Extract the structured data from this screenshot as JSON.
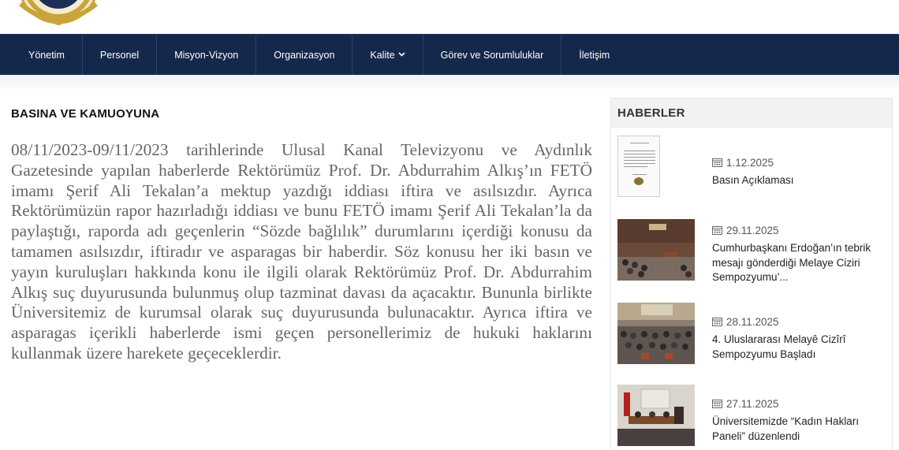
{
  "nav": {
    "items": [
      {
        "label": "Yönetim"
      },
      {
        "label": "Personel"
      },
      {
        "label": "Misyon-Vizyon"
      },
      {
        "label": "Organizasyon"
      },
      {
        "label": "Kalite",
        "has_dropdown": true
      },
      {
        "label": "Görev ve Sorumluluklar"
      },
      {
        "label": "İletişim"
      }
    ]
  },
  "main": {
    "title": "BASINA VE KAMUOYUNA",
    "body": "08/11/2023-09/11/2023 tarihlerinde Ulusal Kanal Televizyonu ve Aydınlık Gazetesinde yapılan haberlerde Rektörümüz Prof. Dr. Abdurrahim Alkış’ın FETÖ imamı Şerif Ali Tekalan’a mektup yazdığı iddiası iftira ve asılsızdır. Ayrıca Rektörümüzün rapor hazırladığı iddiası ve bunu FETÖ imamı Şerif Ali Tekalan’la da paylaştığı, raporda adı geçenlerin “Sözde bağlılık” durumlarını içerdiği konusu da tamamen asılsızdır, iftiradır ve asparagas bir haberdir. Söz konusu her iki basın ve yayın kuruluşları hakkında konu ile ilgili olarak Rektörümüz Prof. Dr. Abdurrahim Alkış suç duyurusunda bulunmuş olup tazminat davası da açacaktır. Bununla birlikte Üniversitemiz de kurumsal olarak suç duyurusunda bulunacaktır. Ayrıca iftira ve asparagas içerikli haberlerde ismi geçen personellerimiz de hukuki haklarını kullanmak üzere harekete geçeceklerdir."
  },
  "sidebar": {
    "title": "HABERLER",
    "news": [
      {
        "date": "1.12.2025",
        "title": "Basın Açıklaması",
        "thumb": "document"
      },
      {
        "date": "29.11.2025",
        "title": "Cumhurbaşkanı Erdoğan’ın tebrik mesajı gönderdiği Melaye Ciziri Sempozyumu’...",
        "thumb": "photo"
      },
      {
        "date": "28.11.2025",
        "title": "4. Uluslararası Melayê Cizîrî Sempozyumu Başladı",
        "thumb": "photo"
      },
      {
        "date": "27.11.2025",
        "title": "Üniversitemizde “Kadın Hakları Paneli” düzenlendi",
        "thumb": "photo"
      }
    ]
  },
  "colors": {
    "navbar": "#14284b",
    "logo_gold": "#c9a43a",
    "text_gray": "#666666"
  },
  "icons": {
    "news_date": "calendar-icon",
    "dropdown": "chevron-down-icon",
    "logo": "university-seal-logo"
  }
}
